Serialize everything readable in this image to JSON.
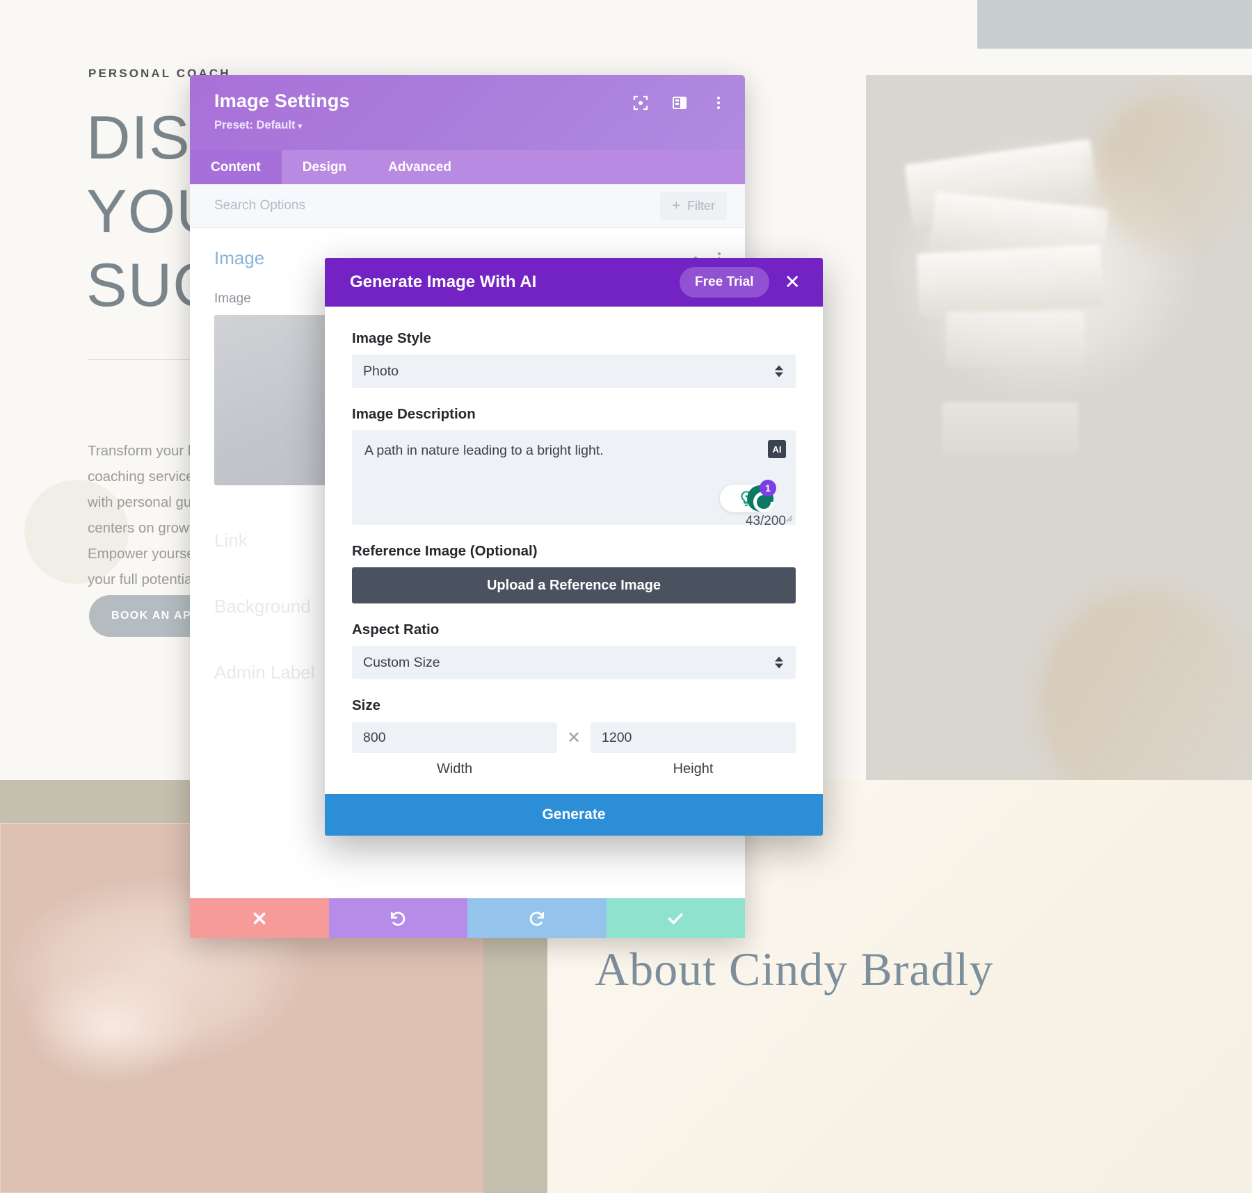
{
  "background_site": {
    "eyebrow": "PERSONAL COACH",
    "hero_line1": "DISCOVER",
    "hero_line2": "YOUR",
    "hero_line3": "SUCCESS",
    "body_text": "Transform your life with our expert coaching services. Achieve your goals with personal guidance. Our philosophy centers on growth, clarity and balance. Empower yourself with the tools to unlock your full potential today.",
    "cta_label": "BOOK AN APPOINTMENT",
    "about_title": "About Cindy Bradly"
  },
  "settings_panel": {
    "title": "Image Settings",
    "preset_label": "Preset: Default",
    "preset_caret": "▾",
    "header_icons": [
      "focus-target-icon",
      "layout-columns-icon",
      "kebab-menu-icon"
    ],
    "tabs": [
      {
        "label": "Content",
        "active": true
      },
      {
        "label": "Design",
        "active": false
      },
      {
        "label": "Advanced",
        "active": false
      }
    ],
    "search_placeholder": "Search Options",
    "filter_label": "Filter",
    "filter_plus": "+",
    "section_title": "Image",
    "field_label": "Image",
    "ghost_options": [
      "Link",
      "Background",
      "Admin Label"
    ],
    "footer_buttons": [
      {
        "name": "cancel",
        "icon": "close-icon",
        "color": "#f79a9a"
      },
      {
        "name": "undo",
        "icon": "undo-icon",
        "color": "#b68ce8"
      },
      {
        "name": "redo",
        "icon": "redo-icon",
        "color": "#94c4ec"
      },
      {
        "name": "save",
        "icon": "check-icon",
        "color": "#8fe2cd"
      }
    ]
  },
  "ai_modal": {
    "title": "Generate Image With AI",
    "free_trial_label": "Free Trial",
    "close_label": "✕",
    "image_style_label": "Image Style",
    "image_style_value": "Photo",
    "image_description_label": "Image Description",
    "image_description_value": "A path in nature leading to a bright light.",
    "ai_badge_label": "AI",
    "char_count": "43/200",
    "grammarly_badge_count": "1",
    "reference_image_label": "Reference Image (Optional)",
    "upload_button_label": "Upload a Reference Image",
    "aspect_ratio_label": "Aspect Ratio",
    "aspect_ratio_value": "Custom Size",
    "size_label": "Size",
    "width_value": "800",
    "height_value": "1200",
    "size_separator": "✕",
    "width_caption": "Width",
    "height_caption": "Height",
    "generate_button_label": "Generate"
  },
  "colors": {
    "panel_header_purple": "#a970d8",
    "panel_tabs_purple": "#b98ae2",
    "modal_header_purple": "#7322c4",
    "generate_blue": "#2c8ed6",
    "upload_dark": "#4a5260",
    "section_title_blue": "#8ab4d8"
  }
}
